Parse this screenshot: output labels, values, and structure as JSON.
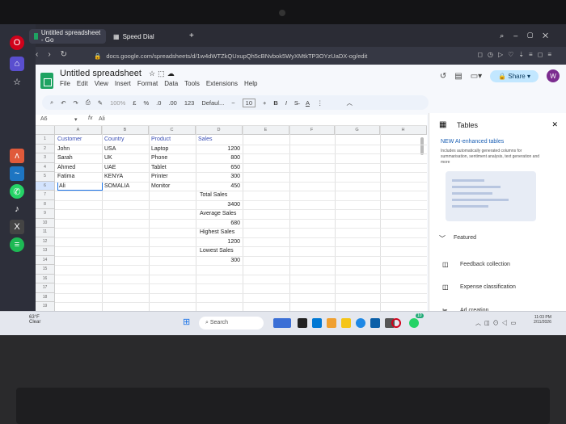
{
  "browser": {
    "tabs": [
      {
        "title": "Untitled spreadsheet - Go",
        "active": true
      },
      {
        "title": "Speed Dial",
        "active": false
      }
    ],
    "url": "docs.google.com/spreadsheets/d/1w4dWTZkQUxupQh5cBNvbok5WyXMtkTP3OYzUaDX-og/edit"
  },
  "sheets": {
    "title": "Untitled spreadsheet",
    "menus": [
      "File",
      "Edit",
      "View",
      "Insert",
      "Format",
      "Data",
      "Tools",
      "Extensions",
      "Help"
    ],
    "share_label": "Share",
    "avatar_letter": "W",
    "toolbar": {
      "zoom": "100%",
      "currency": "£",
      "percent": "%",
      "dec_less": ".0",
      "dec_more": ".00",
      "format123": "123",
      "font": "Defaul...",
      "font_size": "10",
      "bold": "B",
      "italic": "I"
    },
    "name_box": "A6",
    "formula_value": "Ali",
    "columns": [
      "A",
      "B",
      "C",
      "D",
      "E",
      "F",
      "G",
      "H"
    ],
    "rows": [
      "1",
      "2",
      "3",
      "4",
      "5",
      "6",
      "7",
      "8",
      "9",
      "10",
      "11",
      "12",
      "13",
      "14",
      "15",
      "16",
      "17",
      "18",
      "19",
      "20"
    ],
    "headers": {
      "a": "Customer",
      "b": "Country",
      "c": "Product",
      "d": "Sales"
    },
    "data": [
      {
        "customer": "John",
        "country": "USA",
        "product": "Laptop",
        "sales": "1200"
      },
      {
        "customer": "Sarah",
        "country": "UK",
        "product": "Phone",
        "sales": "800"
      },
      {
        "customer": "Ahmed",
        "country": "UAE",
        "product": "Tablet",
        "sales": "650"
      },
      {
        "customer": "Fatima",
        "country": "KENYA",
        "product": "Printer",
        "sales": "300"
      },
      {
        "customer": "Ali",
        "country": "SOMALIA",
        "product": "Monitor",
        "sales": "450"
      }
    ],
    "summary": [
      {
        "label": "Total Sales",
        "value": "3400"
      },
      {
        "label": "Average Sales",
        "value": "680"
      },
      {
        "label": "Highest Sales",
        "value": "1200"
      },
      {
        "label": "Lowest Sales",
        "value": "300"
      }
    ]
  },
  "panel": {
    "title": "Tables",
    "new_heading": "NEW AI-enhanced tables",
    "description": "Includes automatically generated columns for summarisation, sentiment analysis, text generation and more",
    "featured": "Featured",
    "items": [
      "Feedback collection",
      "Expense classification",
      "Ad creation"
    ]
  },
  "taskbar": {
    "search": "Search",
    "weather_temp": "63°F",
    "weather_desc": "Clear",
    "time": "11:03 PM",
    "date": "2/11/2026",
    "badge": "10"
  },
  "colors": {
    "sheets_green": "#1ea362",
    "header_blue": "#3a4fb5",
    "selection_blue": "#1a73e8",
    "share_bg": "#c2e7ff"
  }
}
